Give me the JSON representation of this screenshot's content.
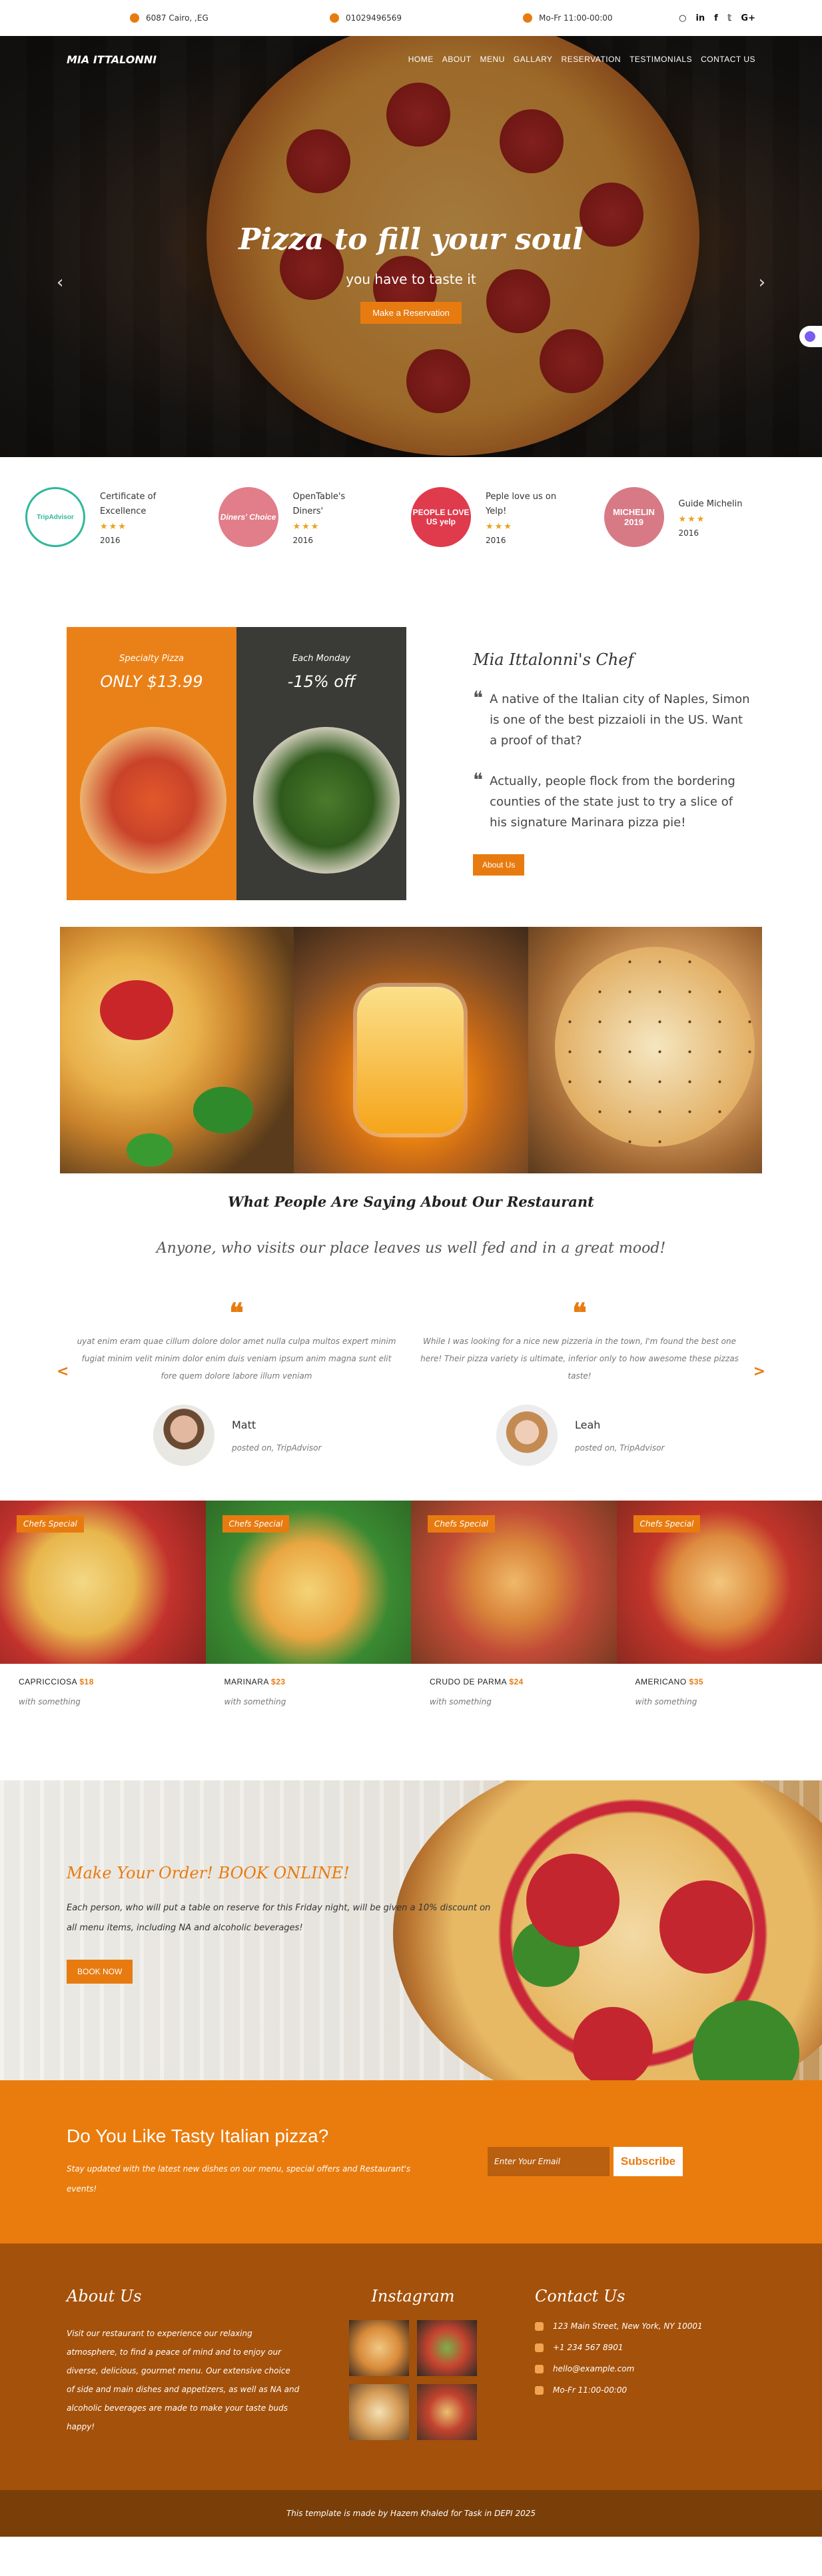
{
  "topbar": {
    "address": "6087 Cairo, ,EG",
    "phone": "01029496569",
    "hours": "Mo-Fr 11:00-00:00",
    "socials": [
      "github",
      "linkedin",
      "facebook",
      "twitter",
      "google-plus"
    ],
    "social_glyphs": [
      "○",
      "in",
      "f",
      "𝕥",
      "G+"
    ]
  },
  "nav": {
    "logo": "MIA ITTALONNI",
    "items": [
      "HOME",
      "ABOUT",
      "MENU",
      "GALLARY",
      "RESERVATION",
      "TESTIMONIALS",
      "CONTACT US"
    ]
  },
  "hero": {
    "title": "Pizza to fill your soul",
    "subtitle": "you have to taste it",
    "button": "Make a Reservation",
    "prev": "‹",
    "next": "›"
  },
  "awards": [
    {
      "badge": "TripAdvisor",
      "name_line1": "Certificate of",
      "name_line2": "Excellence",
      "stars": "★★★",
      "year": "2016"
    },
    {
      "badge": "Diners' Choice",
      "name_line1": "OpenTable's",
      "name_line2": "Diners'",
      "stars": "★★★",
      "year": "2016"
    },
    {
      "badge": "PEOPLE LOVE US yelp",
      "name_line1": "Peple love us on",
      "name_line2": "Yelp!",
      "stars": "★★★",
      "year": "2016"
    },
    {
      "badge": "MICHELIN 2019",
      "name_line1": "Guide Michelin",
      "name_line2": "",
      "stars": "★★★",
      "year": "2016"
    }
  ],
  "promo": {
    "left_label": "Specialty Pizza",
    "left_price": "ONLY $13.99",
    "right_label": "Each Monday",
    "right_price": "-15% off"
  },
  "chef": {
    "title": "Mia Ittalonni's Chef",
    "quote1": "A native of the Italian city of Naples, Simon is one of the best pizzaioli in the US. Want a proof of that?",
    "quote2": "Actually, people flock from the bordering counties of the state just to try a slice of his signature Marinara pizza pie!",
    "button": "About Us"
  },
  "testimonials": {
    "title": "What People Are Saying About Our Restaurant",
    "subtitle": "Anyone, who visits our place leaves us well fed and in a great mood!",
    "quote_mark": "❝",
    "prev": "<",
    "next": ">",
    "items": [
      {
        "text": "uyat enim eram quae cillum dolore dolor amet nulla culpa multos expert minim fugiat minim velit minim dolor enim duis veniam ipsum anim magna sunt elit fore quem dolore labore illum veniam",
        "name": "Matt",
        "posted": "posted on, TripAdvisor"
      },
      {
        "text": "While I was looking for a nice new pizzeria in the town, I'm found the best one here! Their pizza variety is ultimate, inferior only to how awesome these pizzas taste!",
        "name": "Leah",
        "posted": "posted on, TripAdvisor"
      }
    ]
  },
  "menu_items": [
    {
      "tag": "Chefs Special",
      "name": "CAPRICCIOSA",
      "price": "$18",
      "desc": "with something"
    },
    {
      "tag": "Chefs Special",
      "name": "MARINARA",
      "price": "$23",
      "desc": "with something"
    },
    {
      "tag": "Chefs Special",
      "name": "CRUDO DE PARMA",
      "price": "$24",
      "desc": "with something"
    },
    {
      "tag": "Chefs Special",
      "name": "AMERICANO",
      "price": "$35",
      "desc": "with something"
    }
  ],
  "order": {
    "title": "Make Your Order! BOOK ONLINE!",
    "text": "Each person, who will put a table on reserve for this Friday night, will be given a 10% discount on all menu items, including NA and alcoholic beverages!",
    "button": "BOOK NOW"
  },
  "newsletter": {
    "title": "Do You Like Tasty Italian pizza?",
    "text": "Stay updated with the latest new dishes on our menu, special offers and Restaurant's events!",
    "placeholder": "Enter Your Email",
    "button": "Subscribe"
  },
  "footer": {
    "about_title": "About Us",
    "about_text": "Visit our restaurant to experience our relaxing atmosphere, to find a peace of mind and to enjoy our diverse, delicious, gourmet menu. Our extensive choice of side and main dishes and appetizers, as well as NA and alcoholic beverages are made to make your taste buds happy!",
    "insta_title": "Instagram",
    "contact_title": "Contact Us",
    "contact": [
      "123 Main Street, New York, NY 10001",
      "+1 234 567 8901",
      "hello@example.com",
      "Mo-Fr 11:00-00:00"
    ],
    "copyright": "This template is made by Hazem Khaled for Task in DEPI 2025"
  },
  "colors": {
    "accent": "#e87b10",
    "footer": "#a4510b",
    "footer_bottom": "#7a3f09"
  }
}
